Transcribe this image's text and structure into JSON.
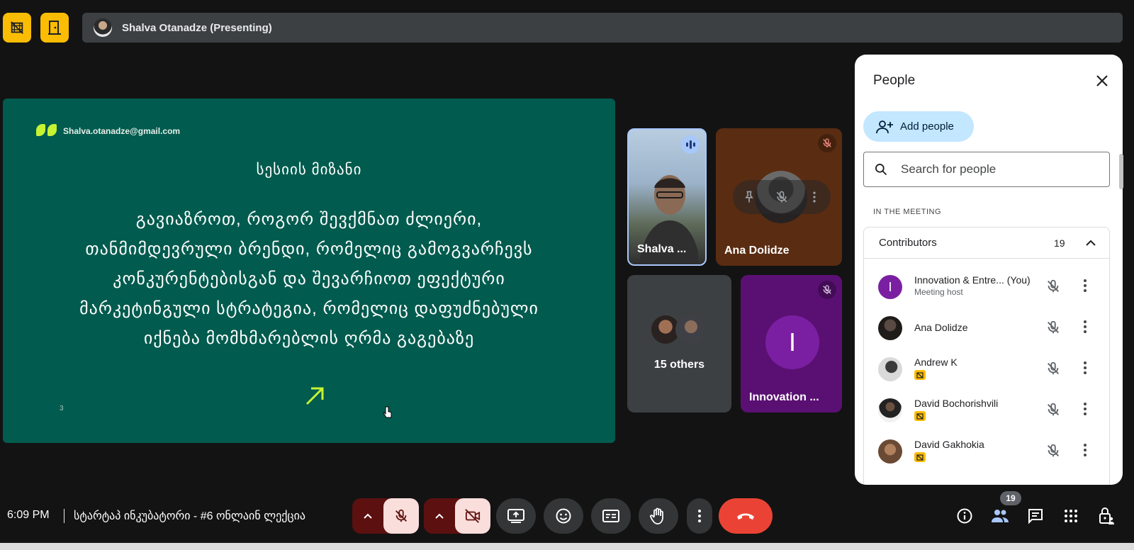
{
  "top_bar": {
    "presenter_label": "Shalva Otanadze (Presenting)"
  },
  "slide": {
    "email": "Shalva.otanadze@gmail.com",
    "title": "სესიის მიზანი",
    "body_lines": [
      "გავიაზროთ, როგორ შევქმნათ ძლიერი,",
      "თანმიმდევრული ბრენდი, რომელიც გამოგვარჩევს",
      "კონკურენტებისგან და შევარჩიოთ ეფექტური",
      "მარკეტინგული სტრატეგია, რომელიც დაფუძნებული",
      "იქნება მომხმარებლის ღრმა გაგებაზე"
    ],
    "page_number": "3",
    "accent_color": "#c6f432"
  },
  "tiles": {
    "shalva": {
      "name": "Shalva ..."
    },
    "ana": {
      "name": "Ana Dolidze"
    },
    "others": {
      "label": "15 others"
    },
    "innovation": {
      "name": "Innovation ...",
      "initial": "I"
    }
  },
  "people_panel": {
    "title": "People",
    "add_people_label": "Add people",
    "search_placeholder": "Search for people",
    "section_label": "IN THE MEETING",
    "contributors_label": "Contributors",
    "contributors_count": "19",
    "participants": [
      {
        "name": "Innovation & Entre... (You)",
        "sub": "Meeting host",
        "initial": "I",
        "avatar_color": "#7b1fa2"
      },
      {
        "name": "Ana Dolidze",
        "sub": ""
      },
      {
        "name": "Andrew K",
        "sub": "",
        "badge": "presentation-badge-icon"
      },
      {
        "name": "David Bochorishvili",
        "sub": "",
        "badge": "presentation-badge-icon"
      },
      {
        "name": "David Gakhokia",
        "sub": "",
        "badge": "presentation-badge-icon"
      }
    ]
  },
  "bottom_bar": {
    "time": "6:09 PM",
    "meeting_name": "სტარტაპ ინკუბატორი - #6 ონლაინ ლექცია",
    "people_count": "19"
  },
  "colors": {
    "slide_bg": "#015b4e",
    "end_call": "#ea4335",
    "warning_yellow": "#fbbc04",
    "add_people_bg": "#c2e7ff"
  }
}
